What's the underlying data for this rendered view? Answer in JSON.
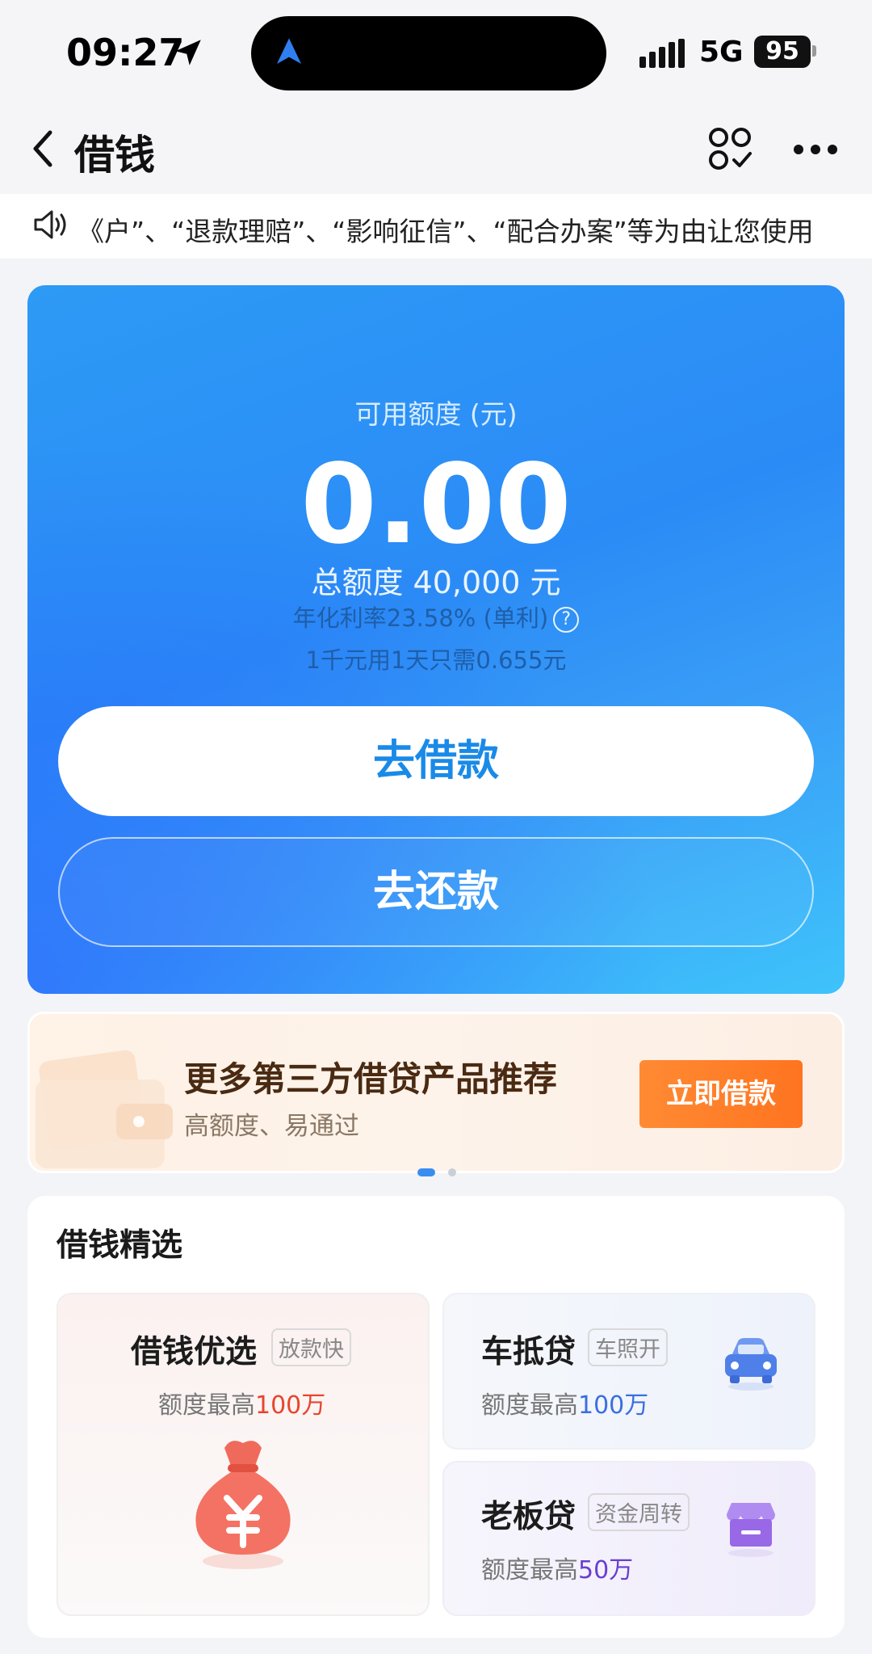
{
  "status_bar": {
    "time": "09:27",
    "network": "5G",
    "battery": "95"
  },
  "nav": {
    "title": "借钱"
  },
  "notice": {
    "text": "《户”、“退款理赔”、“影响征信”、“配合办案”等为由让您使用"
  },
  "credit": {
    "available_label": "可用额度 (元)",
    "available_amount": "0.00",
    "total_line": "总额度 40,000 元",
    "rate_line": "年化利率23.58% (单利)",
    "cost_line": "1千元用1天只需0.655元",
    "borrow_label": "去借款",
    "repay_label": "去还款"
  },
  "promo": {
    "title": "更多第三方借贷产品推荐",
    "subtitle": "高额度、易通过",
    "button_label": "立即借款",
    "page_index": 1,
    "page_count": 2
  },
  "selection": {
    "title": "借钱精选",
    "products": [
      {
        "name": "借钱优选",
        "tag": "放款快",
        "quota_prefix": "额度最高",
        "quota_value": "100万",
        "icon": "money-bag-icon",
        "accent": "#e8452c"
      },
      {
        "name": "车抵贷",
        "tag": "车照开",
        "quota_prefix": "额度最高",
        "quota_value": "100万",
        "icon": "car-icon",
        "accent": "#3a6fe0"
      },
      {
        "name": "老板贷",
        "tag": "资金周转",
        "quota_prefix": "额度最高",
        "quota_value": "50万",
        "icon": "shop-icon",
        "accent": "#6a3fd0"
      }
    ]
  },
  "colors": {
    "card_blue": "#2b8bf6",
    "promo_orange": "#ff7a26",
    "page_bg": "#f3f4f7"
  }
}
